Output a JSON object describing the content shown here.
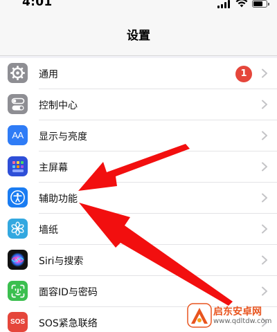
{
  "status_bar": {
    "time": "4:01"
  },
  "header": {
    "title": "设置"
  },
  "settings": {
    "items": [
      {
        "label": "通用",
        "icon": "gear-icon",
        "color": "#8e8e93",
        "badge": "1"
      },
      {
        "label": "控制中心",
        "icon": "toggle-switches-icon",
        "color": "#8e8e93"
      },
      {
        "label": "显示与亮度",
        "icon": "text-size-icon",
        "color": "#2f7cf6",
        "icon_text": "AA"
      },
      {
        "label": "主屏幕",
        "icon": "home-screen-grid-icon",
        "color": "#2e4fd8"
      },
      {
        "label": "辅助功能",
        "icon": "accessibility-person-icon",
        "color": "#1a7cf2"
      },
      {
        "label": "墙纸",
        "icon": "flower-icon",
        "color": "#33a8e0"
      },
      {
        "label": "Siri与搜索",
        "icon": "siri-icon",
        "color": "#111111"
      },
      {
        "label": "面容ID与密码",
        "icon": "face-id-icon",
        "color": "#3bbf4f"
      },
      {
        "label": "SOS紧急联络",
        "icon": "sos-icon",
        "color": "#e5463b",
        "icon_text": "SOS"
      }
    ]
  },
  "annotations": {
    "arrow_color": "#f20f0f",
    "arrow_target": "辅助功能"
  },
  "watermark": {
    "name": "启东安卓网",
    "url": "www.qdltdw.com"
  }
}
